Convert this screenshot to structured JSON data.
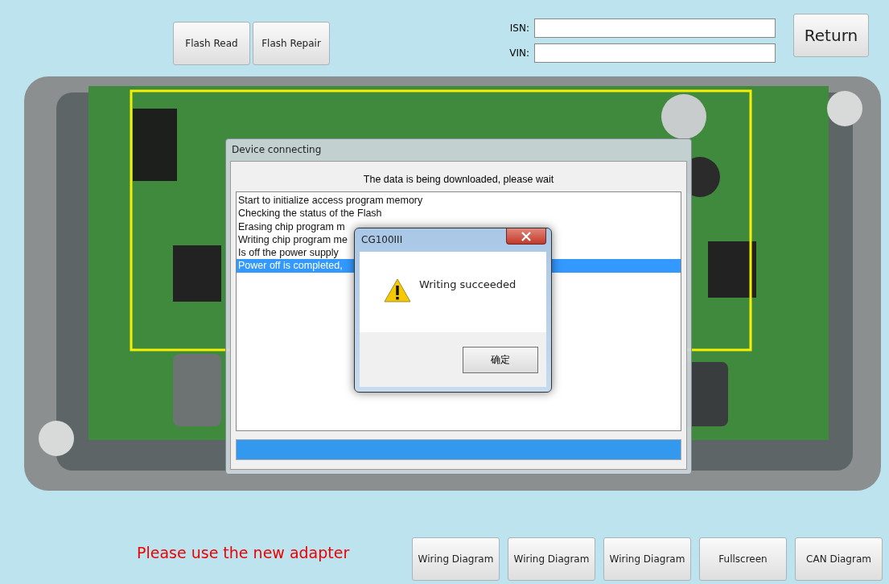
{
  "top_buttons": [
    "Flash Read",
    "Flash Repair"
  ],
  "fields": [
    {
      "label": "ISN:"
    },
    {
      "label": "VIN:"
    }
  ],
  "return_button": "Return",
  "photo": {
    "kind": "picture"
  },
  "progress_window": {
    "title": "Device connecting",
    "message": "The data is being downloaded, please wait",
    "log": [
      {
        "text": "Start to initialize access program memory",
        "selected": false
      },
      {
        "text": "Checking the status of the Flash",
        "selected": false
      },
      {
        "text": "Erasing chip program m",
        "selected": false
      },
      {
        "text": "Writing chip program me",
        "selected": false
      },
      {
        "text": "Is off the power supply",
        "selected": false
      },
      {
        "text": "Power off is completed,",
        "selected": true
      }
    ],
    "progress": {
      "level": 1
    }
  },
  "message_box": {
    "title": "CG100III",
    "text": "Writing succeeded",
    "button": "确定"
  },
  "notice": "Please use the new adapter",
  "bottom_buttons": [
    "Wiring Diagram",
    "Wiring Diagram",
    "Wiring Diagram",
    "Fullscreen",
    "CAN Diagram"
  ]
}
